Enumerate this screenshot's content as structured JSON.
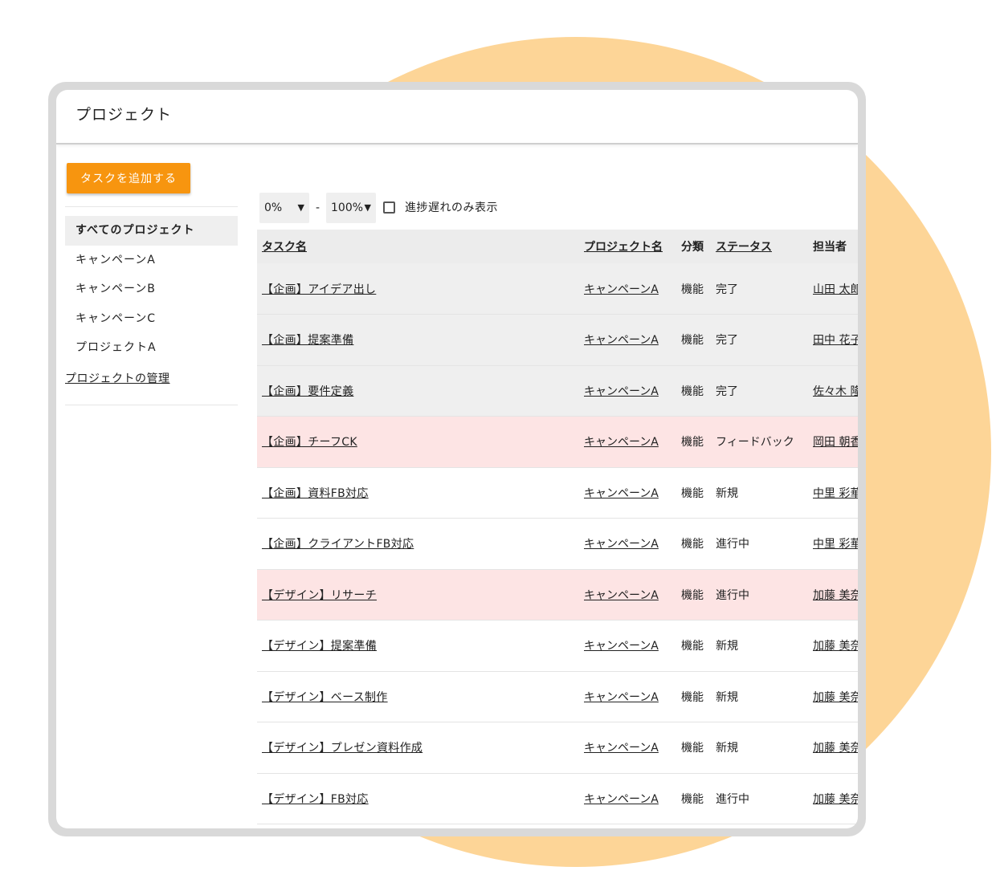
{
  "colors": {
    "background_circle": "#fdd597",
    "accent_button": "#f7950f",
    "row_gray": "#efefef",
    "row_delayed": "#fde4e4"
  },
  "header": {
    "title": "プロジェクト"
  },
  "sidebar": {
    "add_button_label": "タスクを追加する",
    "items": [
      {
        "label": "すべてのプロジェクト"
      },
      {
        "label": "キャンペーンA"
      },
      {
        "label": "キャンペーンB"
      },
      {
        "label": "キャンペーンC"
      },
      {
        "label": "プロジェクトA"
      }
    ],
    "manage_link": "プロジェクトの管理"
  },
  "filters": {
    "progress_min": "0%",
    "range_separator": "-",
    "progress_max": "100%",
    "delayed_only_label": "進捗遅れのみ表示",
    "delayed_only_checked": false
  },
  "table": {
    "headers": {
      "task": "タスク名",
      "project": "プロジェクト名",
      "type": "分類",
      "status": "ステータス",
      "assignee": "担当者"
    },
    "rows": [
      {
        "task": "【企画】アイデア出し",
        "project": "キャンペーンA",
        "type": "機能",
        "status": "完了",
        "assignee": "山田 太郎",
        "highlight": "gray"
      },
      {
        "task": "【企画】提案準備",
        "project": "キャンペーンA",
        "type": "機能",
        "status": "完了",
        "assignee": "田中 花子",
        "highlight": "gray"
      },
      {
        "task": "【企画】要件定義",
        "project": "キャンペーンA",
        "type": "機能",
        "status": "完了",
        "assignee": "佐々木 隆",
        "highlight": "gray"
      },
      {
        "task": "【企画】チーフCK",
        "project": "キャンペーンA",
        "type": "機能",
        "status": "フィードバック",
        "assignee": "岡田 朝香",
        "highlight": "red"
      },
      {
        "task": "【企画】資料FB対応",
        "project": "キャンペーンA",
        "type": "機能",
        "status": "新規",
        "assignee": "中里 彩華",
        "highlight": "none"
      },
      {
        "task": "【企画】クライアントFB対応",
        "project": "キャンペーンA",
        "type": "機能",
        "status": "進行中",
        "assignee": "中里 彩華",
        "highlight": "none"
      },
      {
        "task": "【デザイン】リサーチ",
        "project": "キャンペーンA",
        "type": "機能",
        "status": "進行中",
        "assignee": "加藤 美奈",
        "highlight": "red"
      },
      {
        "task": "【デザイン】提案準備",
        "project": "キャンペーンA",
        "type": "機能",
        "status": "新規",
        "assignee": "加藤 美奈",
        "highlight": "none"
      },
      {
        "task": "【デザイン】ベース制作",
        "project": "キャンペーンA",
        "type": "機能",
        "status": "新規",
        "assignee": "加藤 美奈",
        "highlight": "none"
      },
      {
        "task": "【デザイン】プレゼン資料作成",
        "project": "キャンペーンA",
        "type": "機能",
        "status": "新規",
        "assignee": "加藤 美奈",
        "highlight": "none"
      },
      {
        "task": "【デザイン】FB対応",
        "project": "キャンペーンA",
        "type": "機能",
        "status": "進行中",
        "assignee": "加藤 美奈",
        "highlight": "none"
      }
    ]
  }
}
